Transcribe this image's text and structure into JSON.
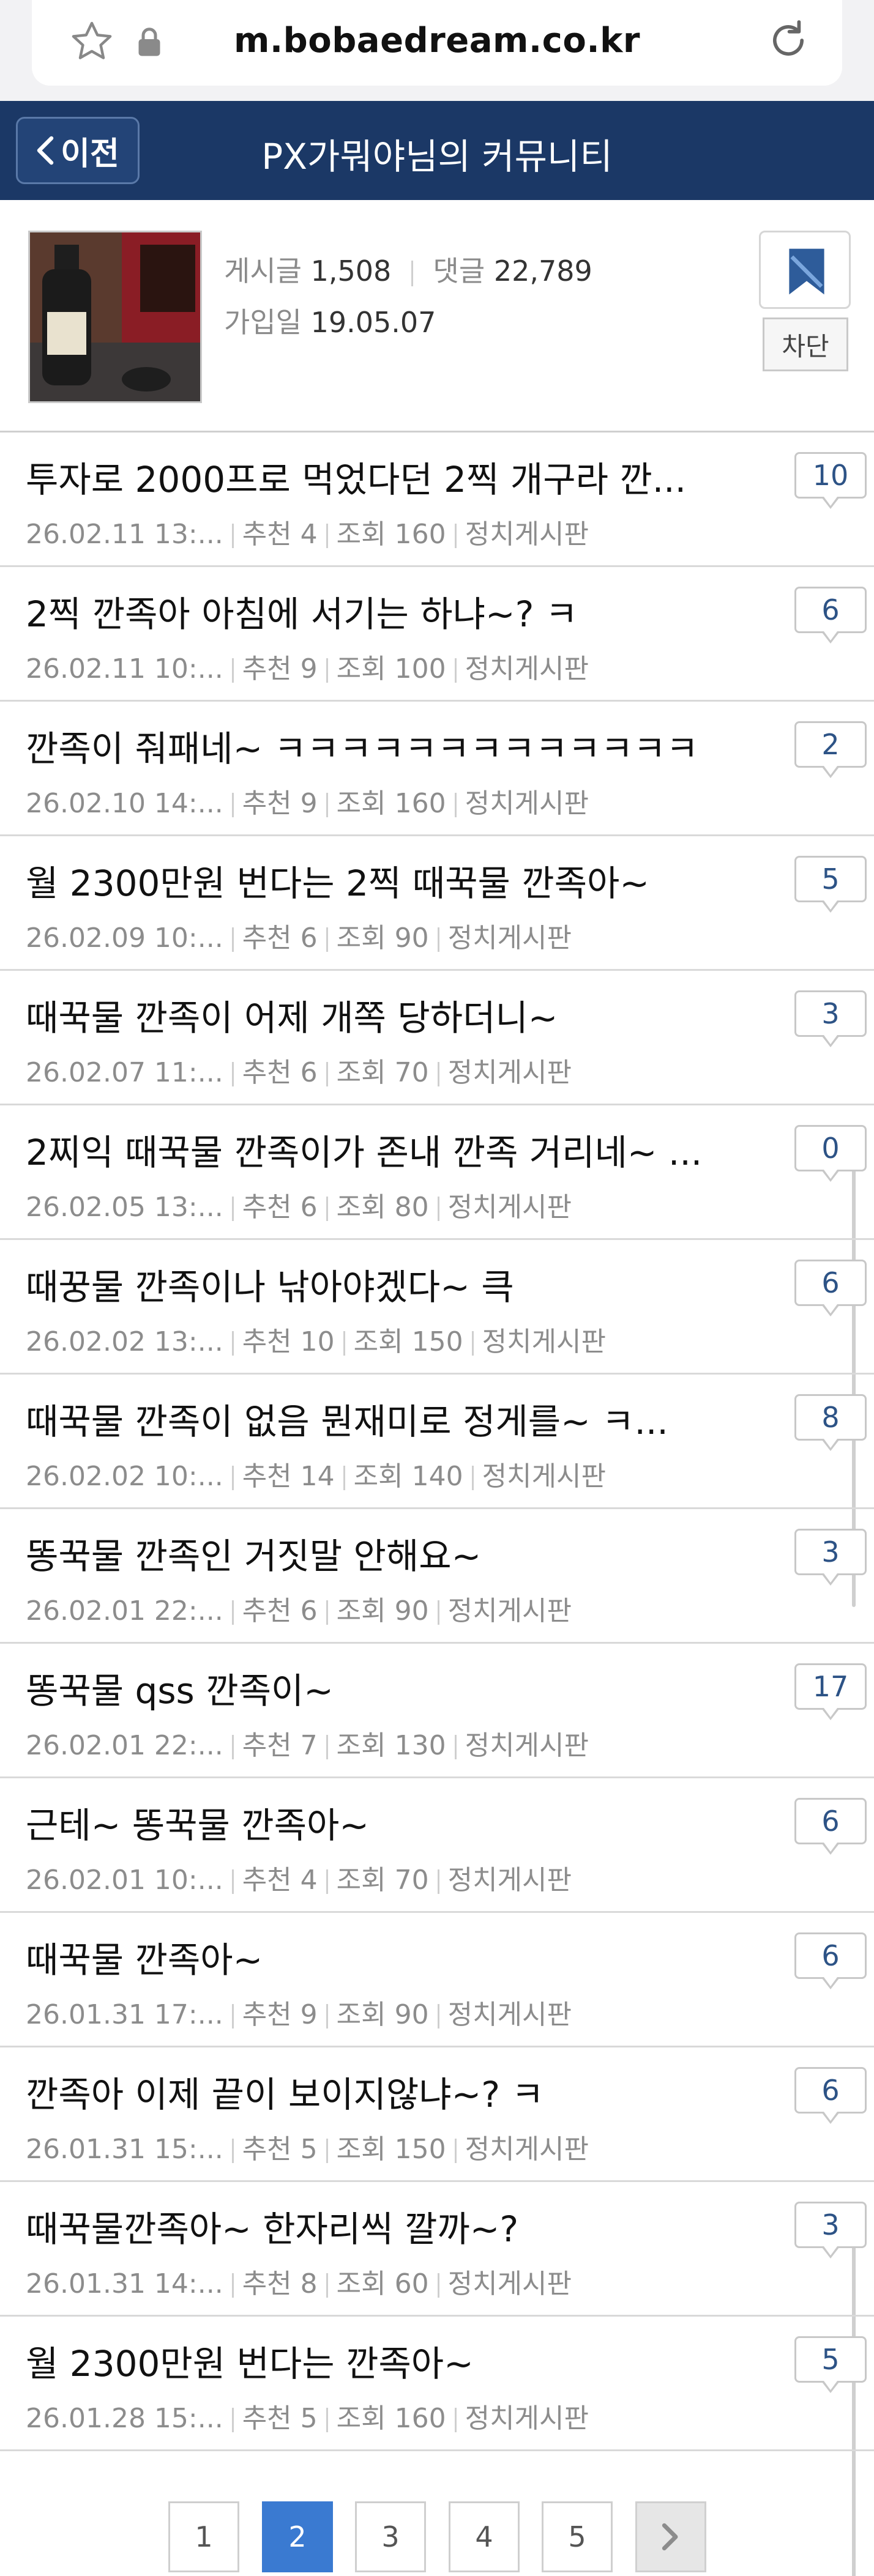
{
  "browser": {
    "url": "m.bobaedream.co.kr"
  },
  "header": {
    "back_label": "이전",
    "title": "PX가뭐야님의 커뮤니티"
  },
  "profile": {
    "posts_label": "게시글",
    "posts_count": "1,508",
    "comments_label": "댓글",
    "comments_count": "22,789",
    "joined_label": "가입일",
    "joined_date": "19.05.07",
    "block_label": "차단"
  },
  "posts": [
    {
      "title": "투자로 2000프로 먹었다던 2찍 개구라 깐...",
      "date": "26.02.11 13:...",
      "recommend": "추천 4",
      "views": "조회 160",
      "board": "정치게시판",
      "comments": "10"
    },
    {
      "title": "2찍 깐족아 아침에 서기는 하냐~? ㅋ",
      "date": "26.02.11 10:...",
      "recommend": "추천 9",
      "views": "조회 100",
      "board": "정치게시판",
      "comments": "6"
    },
    {
      "title": "깐족이 줘패네~ ㅋㅋㅋㅋㅋㅋㅋㅋㅋㅋㅋㅋㅋ",
      "date": "26.02.10 14:...",
      "recommend": "추천 9",
      "views": "조회 160",
      "board": "정치게시판",
      "comments": "2"
    },
    {
      "title": "월 2300만원 번다는 2찍 때꾹물 깐족아~",
      "date": "26.02.09 10:...",
      "recommend": "추천 6",
      "views": "조회 90",
      "board": "정치게시판",
      "comments": "5"
    },
    {
      "title": "때꾹물 깐족이 어제 개쪽 당하더니~",
      "date": "26.02.07 11:...",
      "recommend": "추천 6",
      "views": "조회 70",
      "board": "정치게시판",
      "comments": "3"
    },
    {
      "title": "2찌익 때꾹물 깐족이가 존내 깐족 거리네~ ...",
      "date": "26.02.05 13:...",
      "recommend": "추천 6",
      "views": "조회 80",
      "board": "정치게시판",
      "comments": "0"
    },
    {
      "title": "때꿍물 깐족이나 낚아야겠다~ 큭",
      "date": "26.02.02 13:...",
      "recommend": "추천 10",
      "views": "조회 150",
      "board": "정치게시판",
      "comments": "6"
    },
    {
      "title": "때꾹물 깐족이 없음 뭔재미로 정게를~ ㅋ...",
      "date": "26.02.02 10:...",
      "recommend": "추천 14",
      "views": "조회 140",
      "board": "정치게시판",
      "comments": "8"
    },
    {
      "title": "똥꾹물 깐족인 거짓말 안해요~",
      "date": "26.02.01 22:...",
      "recommend": "추천 6",
      "views": "조회 90",
      "board": "정치게시판",
      "comments": "3"
    },
    {
      "title": "똥꾹물 qss 깐족이~",
      "date": "26.02.01 22:...",
      "recommend": "추천 7",
      "views": "조회 130",
      "board": "정치게시판",
      "comments": "17"
    },
    {
      "title": "근테~ 똥꾹물 깐족아~",
      "date": "26.02.01 10:...",
      "recommend": "추천 4",
      "views": "조회 70",
      "board": "정치게시판",
      "comments": "6"
    },
    {
      "title": "때꾹물 깐족아~",
      "date": "26.01.31 17:...",
      "recommend": "추천 9",
      "views": "조회 90",
      "board": "정치게시판",
      "comments": "6"
    },
    {
      "title": "깐족아 이제 끝이 보이지않냐~? ㅋ",
      "date": "26.01.31 15:...",
      "recommend": "추천 5",
      "views": "조회 150",
      "board": "정치게시판",
      "comments": "6"
    },
    {
      "title": "때꾹물깐족아~ 한자리씩 깔까~?",
      "date": "26.01.31 14:...",
      "recommend": "추천 8",
      "views": "조회 60",
      "board": "정치게시판",
      "comments": "3"
    },
    {
      "title": "월 2300만원 번다는 깐족아~",
      "date": "26.01.28 15:...",
      "recommend": "추천 5",
      "views": "조회 160",
      "board": "정치게시판",
      "comments": "5"
    }
  ],
  "pagination": {
    "pages": [
      "1",
      "2",
      "3",
      "4",
      "5"
    ],
    "current": "2"
  },
  "colors": {
    "header_bg": "#1b3866",
    "active_page": "#3a7ad1",
    "badge_text": "#2d5386"
  }
}
